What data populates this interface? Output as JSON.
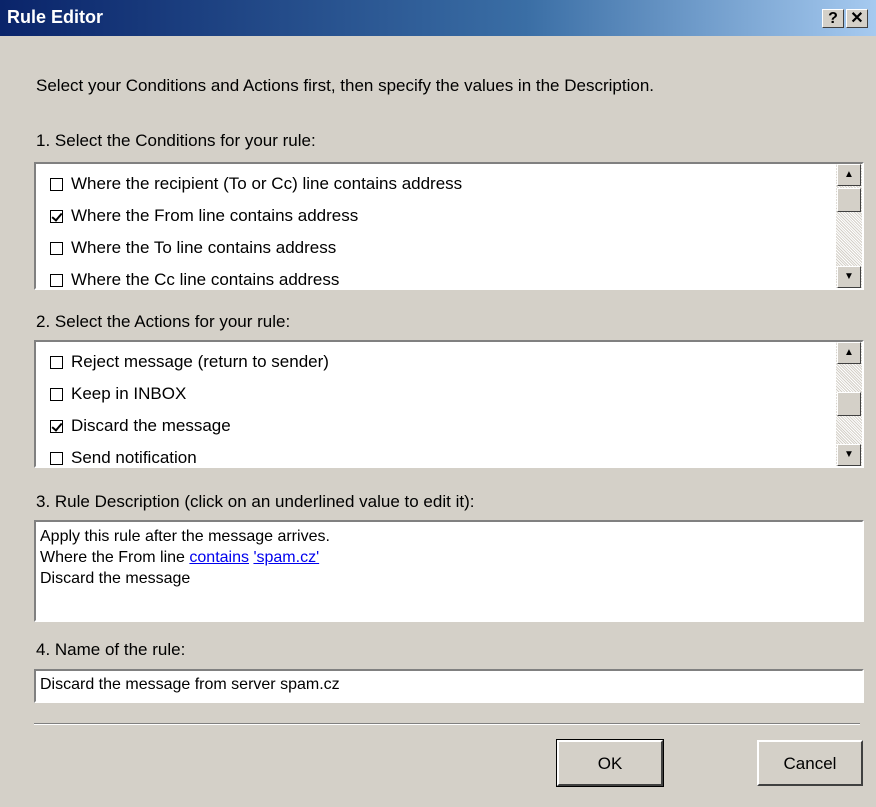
{
  "window": {
    "title": "Rule Editor",
    "help_glyph": "?",
    "close_glyph": "✕"
  },
  "instructions": "Select your Conditions and Actions first, then specify the values in the Description.",
  "conditions": {
    "label": "1. Select the Conditions for your rule:",
    "items": [
      {
        "label": "Where the recipient (To or Cc) line contains address",
        "checked": false
      },
      {
        "label": "Where the From line contains address",
        "checked": true
      },
      {
        "label": "Where the To line contains address",
        "checked": false
      },
      {
        "label": "Where the Cc line contains address",
        "checked": false
      }
    ]
  },
  "actions": {
    "label": "2. Select the Actions for your rule:",
    "items": [
      {
        "label": "Reject message (return to sender)",
        "checked": false
      },
      {
        "label": "Keep in INBOX",
        "checked": false
      },
      {
        "label": "Discard the message",
        "checked": true
      },
      {
        "label": "Send notification",
        "checked": false
      }
    ]
  },
  "description": {
    "label": "3. Rule Description (click on an underlined value to edit it):",
    "line1": "Apply this rule after the message arrives.",
    "line2_prefix": "Where the From line ",
    "line2_link1": "contains",
    "line2_link2": "'spam.cz'",
    "line3": "Discard the message"
  },
  "rule_name": {
    "label": "4. Name of the rule:",
    "value": "Discard the message from server spam.cz"
  },
  "buttons": {
    "ok": "OK",
    "cancel": "Cancel"
  }
}
